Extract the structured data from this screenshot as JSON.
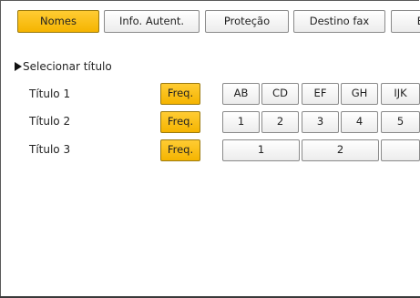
{
  "tabs": [
    {
      "label": "Nomes",
      "active": true
    },
    {
      "label": "Info. Autent.",
      "active": false
    },
    {
      "label": "Proteção",
      "active": false
    },
    {
      "label": "Destino fax",
      "active": false
    },
    {
      "label": "E",
      "active": false
    }
  ],
  "section": {
    "heading": "Selecionar título"
  },
  "rows": [
    {
      "label": "Título 1",
      "cells": [
        "Freq.",
        "AB",
        "CD",
        "EF",
        "GH",
        "IJK"
      ]
    },
    {
      "label": "Título 2",
      "cells": [
        "Freq.",
        "1",
        "2",
        "3",
        "4",
        "5"
      ]
    },
    {
      "label": "Título 3",
      "cells": [
        "Freq.",
        "1",
        "2",
        ""
      ]
    }
  ],
  "colors": {
    "active": "#f5b400",
    "border": "#8a8a8a"
  }
}
